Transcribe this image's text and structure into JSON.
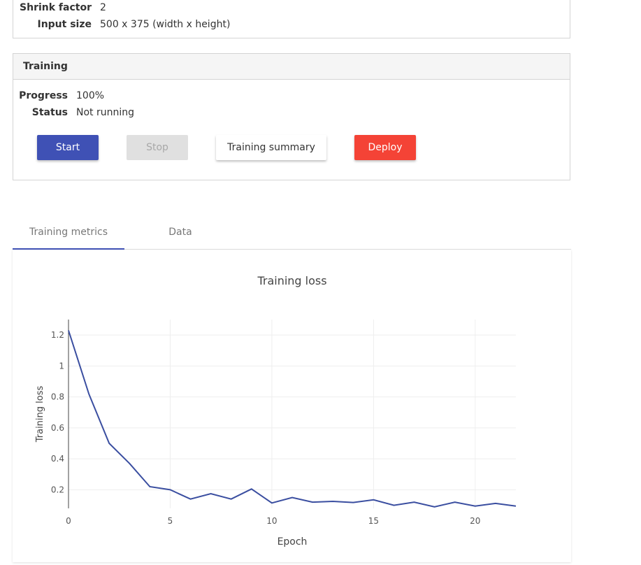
{
  "model_info": {
    "rows": [
      {
        "label": "Shrink factor",
        "value": "2"
      },
      {
        "label": "Input size",
        "value": "500 x 375 (width x height)"
      }
    ]
  },
  "training": {
    "title": "Training",
    "progress_label": "Progress",
    "progress_value": "100%",
    "status_label": "Status",
    "status_value": "Not running",
    "buttons": {
      "start": "Start",
      "stop": "Stop",
      "summary": "Training summary",
      "deploy": "Deploy"
    }
  },
  "tabs": [
    {
      "label": "Training metrics",
      "active": true
    },
    {
      "label": "Data",
      "active": false
    }
  ],
  "colors": {
    "primary": "#3f51b5",
    "danger": "#f44336",
    "disabled": "#e0e0e0",
    "line": "#3a4ea0"
  },
  "chart_data": {
    "type": "line",
    "title": "Training loss",
    "xlabel": "Epoch",
    "ylabel": "Training loss",
    "x": [
      0,
      1,
      2,
      3,
      4,
      5,
      6,
      7,
      8,
      9,
      10,
      11,
      12,
      13,
      14,
      15,
      16,
      17,
      18,
      19,
      20,
      21,
      22
    ],
    "series": [
      {
        "values": [
          1.23,
          0.82,
          0.5,
          0.37,
          0.22,
          0.2,
          0.14,
          0.175,
          0.14,
          0.205,
          0.115,
          0.15,
          0.12,
          0.125,
          0.118,
          0.135,
          0.1,
          0.12,
          0.09,
          0.12,
          0.095,
          0.112,
          0.095
        ]
      }
    ],
    "xlim": [
      0,
      22
    ],
    "ylim": [
      0.08,
      1.3
    ],
    "xticks": [
      0,
      5,
      10,
      15,
      20
    ],
    "yticks": [
      0.2,
      0.4,
      0.6,
      0.8,
      1,
      1.2
    ],
    "xtick_labels": [
      "0",
      "5",
      "10",
      "15",
      "20"
    ],
    "ytick_labels": [
      "0.2",
      "0.4",
      "0.6",
      "0.8",
      "1",
      "1.2"
    ],
    "grid": true
  }
}
